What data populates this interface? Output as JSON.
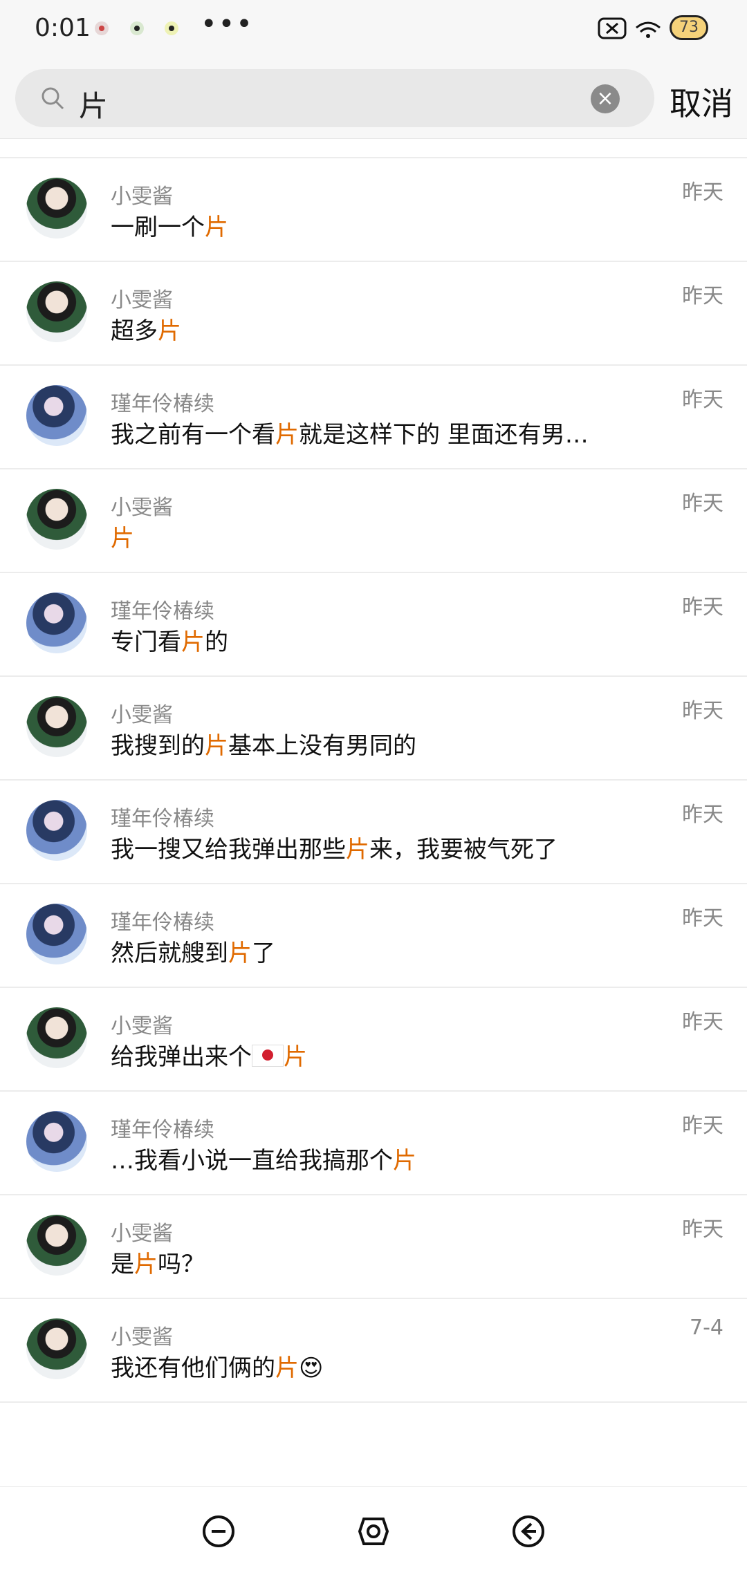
{
  "status_bar": {
    "time": "0:01",
    "dots": "•••",
    "battery": "73"
  },
  "search": {
    "query": "片",
    "clear_icon": "×",
    "cancel_label": "取消"
  },
  "results": [
    {
      "name": "小雯酱",
      "time": "昨天",
      "avatar": "a",
      "pre": "一刷一个",
      "hl": "片",
      "post": ""
    },
    {
      "name": "小雯酱",
      "time": "昨天",
      "avatar": "a",
      "pre": "超多",
      "hl": "片",
      "post": ""
    },
    {
      "name": "瑾年伶椿续",
      "time": "昨天",
      "avatar": "b",
      "pre": "我之前有一个看",
      "hl": "片",
      "post": "就是这样下的 里面还有男…"
    },
    {
      "name": "小雯酱",
      "time": "昨天",
      "avatar": "a",
      "pre": "",
      "hl": "片",
      "post": ""
    },
    {
      "name": "瑾年伶椿续",
      "time": "昨天",
      "avatar": "b",
      "pre": "专门看",
      "hl": "片",
      "post": "的"
    },
    {
      "name": "小雯酱",
      "time": "昨天",
      "avatar": "a",
      "pre": "我搜到的",
      "hl": "片",
      "post": "基本上没有男同的"
    },
    {
      "name": "瑾年伶椿续",
      "time": "昨天",
      "avatar": "b",
      "pre": "我一搜又给我弹出那些",
      "hl": "片",
      "post": "来，我要被气死了"
    },
    {
      "name": "瑾年伶椿续",
      "time": "昨天",
      "avatar": "b",
      "pre": "然后就艘到",
      "hl": "片",
      "post": "了"
    },
    {
      "name": "小雯酱",
      "time": "昨天",
      "avatar": "a",
      "pre": "给我弹出来个",
      "hl": "片",
      "post": "",
      "flag": true
    },
    {
      "name": "瑾年伶椿续",
      "time": "昨天",
      "avatar": "b",
      "pre": "…我看小说一直给我搞那个",
      "hl": "片",
      "post": ""
    },
    {
      "name": "小雯酱",
      "time": "昨天",
      "avatar": "a",
      "pre": "是",
      "hl": "片",
      "post": "吗？"
    },
    {
      "name": "小雯酱",
      "time": "7-4",
      "avatar": "a",
      "pre": "我还有他们俩的",
      "hl": "片",
      "post": "😍"
    }
  ]
}
